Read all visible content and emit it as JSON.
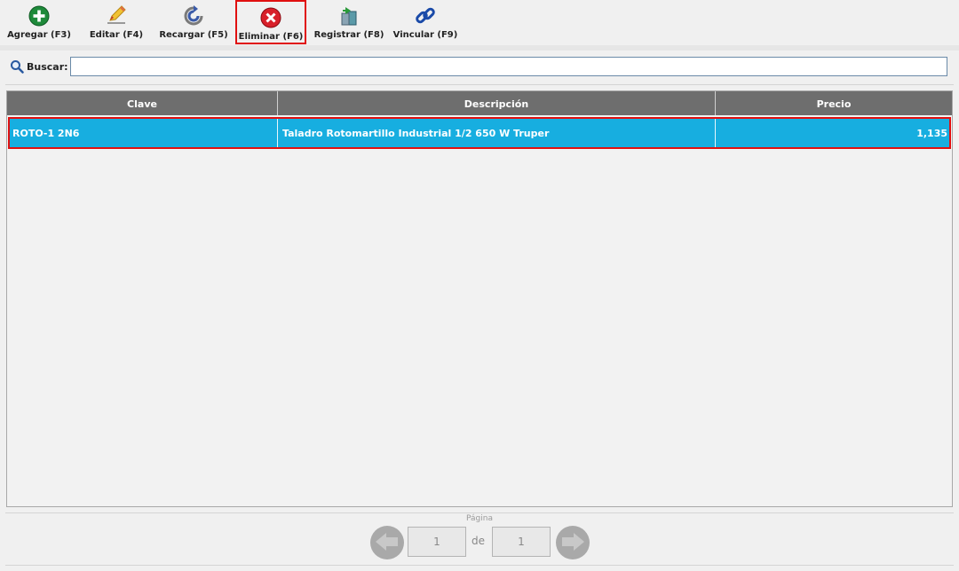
{
  "toolbar": {
    "items": [
      {
        "label": "Agregar (F3)",
        "icon": "add-icon",
        "color": "#1e8a3a"
      },
      {
        "label": "Editar (F4)",
        "icon": "pencil-icon",
        "color": "#e8b43a"
      },
      {
        "label": "Recargar (F5)",
        "icon": "reload-icon",
        "color": "#3a5aa8"
      },
      {
        "label": "Eliminar (F6)",
        "icon": "delete-icon",
        "color": "#d8202a"
      },
      {
        "label": "Registrar (F8)",
        "icon": "register-icon",
        "color": "#3a8a9a"
      },
      {
        "label": "Vincular (F9)",
        "icon": "link-icon",
        "color": "#1a4aa8"
      }
    ]
  },
  "search": {
    "label": "Buscar:",
    "value": "",
    "placeholder": ""
  },
  "table": {
    "columns": [
      "Clave",
      "Descripción",
      "Precio"
    ],
    "rows": [
      {
        "clave": "ROTO-1 2N6",
        "descripcion": "Taladro Rotomartillo Industrial 1/2 650 W Truper",
        "precio": "1,135"
      }
    ]
  },
  "pager": {
    "label": "Página",
    "current": "1",
    "de": "de",
    "total": "1"
  },
  "colors": {
    "header_bg": "#6e6e6e",
    "selected_row": "#17aee0",
    "highlight": "#e01010"
  }
}
